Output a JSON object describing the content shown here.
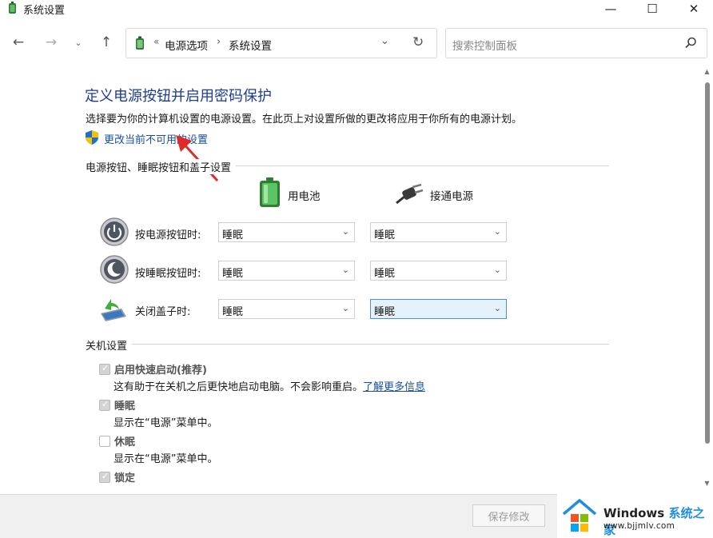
{
  "window": {
    "title": "系统设置",
    "minimize_glyph": "—",
    "maximize_glyph": "☐",
    "close_glyph": "✕"
  },
  "nav": {
    "back_glyph": "←",
    "forward_glyph": "→",
    "recent_glyph": "⌄",
    "up_glyph": "↑",
    "address_chevron": "«",
    "breadcrumb": [
      "电源选项",
      "系统设置"
    ],
    "breadcrumb_sep": "›",
    "dropdown_glyph": "⌄",
    "refresh_glyph": "↻",
    "search_placeholder": "搜索控制面板"
  },
  "content": {
    "title": "定义电源按钮并启用密码保护",
    "description": "选择要为你的计算机设置的电源设置。在此页上对设置所做的更改将应用于你所有的电源计划。",
    "change_link": "更改当前不可用的设置",
    "power_section": {
      "label": "电源按钮、睡眠按钮和盖子设置",
      "col_battery": "用电池",
      "col_plugged": "接通电源",
      "rows": [
        {
          "label": "按电源按钮时:",
          "battery": "睡眠",
          "plugged": "睡眠",
          "icon": "power-button-icon"
        },
        {
          "label": "按睡眠按钮时:",
          "battery": "睡眠",
          "plugged": "睡眠",
          "icon": "sleep-button-icon"
        },
        {
          "label": "关闭盖子时:",
          "battery": "睡眠",
          "plugged": "睡眠",
          "icon": "laptop-lid-icon"
        }
      ]
    },
    "shutdown_section": {
      "label": "关机设置",
      "items": [
        {
          "label": "启用快速启动(推荐)",
          "checked": true,
          "disabled": true,
          "desc": "这有助于在关机之后更快地启动电脑。不会影响重启。",
          "link": "了解更多信息"
        },
        {
          "label": "睡眠",
          "checked": true,
          "disabled": true,
          "desc": "显示在“电源”菜单中。"
        },
        {
          "label": "休眠",
          "checked": false,
          "disabled": true,
          "desc": "显示在“电源”菜单中。"
        },
        {
          "label": "锁定",
          "checked": true,
          "disabled": true,
          "desc": ""
        }
      ]
    },
    "tick_glyph": "✓",
    "select_chev": "⌄"
  },
  "footer": {
    "save_label": "保存修改"
  },
  "watermark": {
    "brand_en": "Windows",
    "brand_cn": "系统之家",
    "url": "www.bjjmlv.com"
  },
  "colors": {
    "title_blue": "#1e3d8f",
    "link_blue": "#1a4fa0",
    "annotation_red": "#e02a2a",
    "focus_border": "#4d90d6"
  }
}
